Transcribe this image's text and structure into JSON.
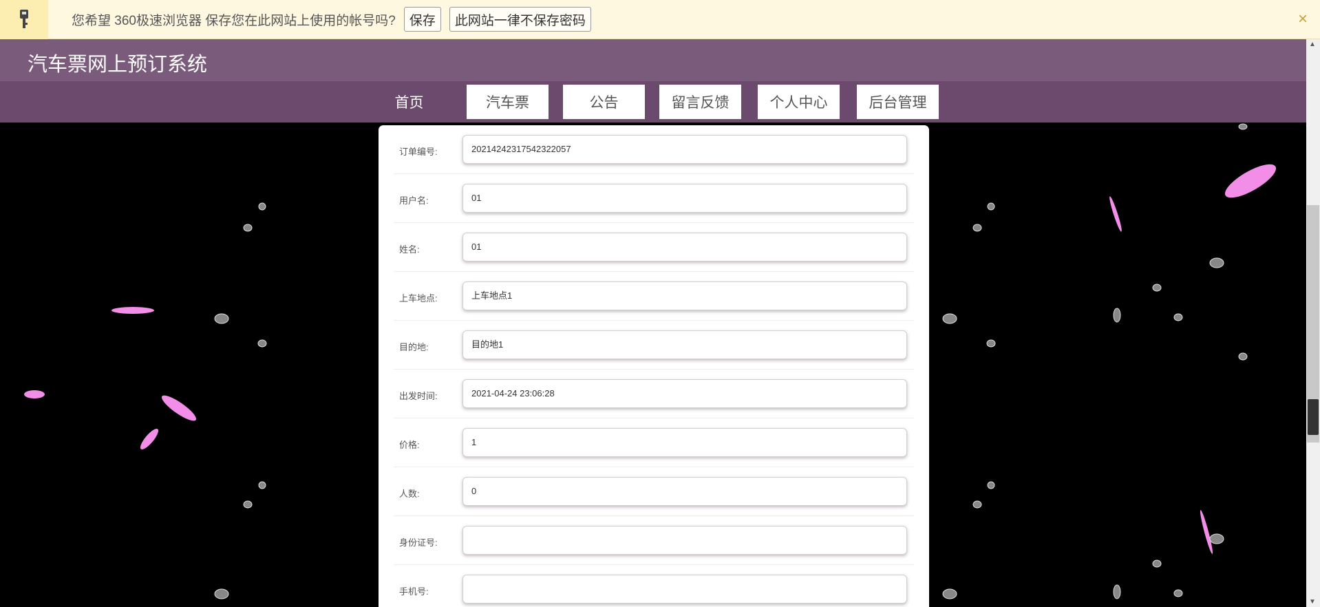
{
  "infobar": {
    "message": "您希望 360极速浏览器 保存您在此网站上使用的帐号吗?",
    "save_label": "保存",
    "never_label": "此网站一律不保存密码",
    "close_icon": "×",
    "colors": {
      "bg": "#fff8e1"
    }
  },
  "header": {
    "title": "汽车票网上预订系统"
  },
  "nav": {
    "items": [
      {
        "label": "首页"
      },
      {
        "label": "汽车票"
      },
      {
        "label": "公告"
      },
      {
        "label": "留言反馈"
      },
      {
        "label": "个人中心"
      },
      {
        "label": "后台管理"
      }
    ]
  },
  "form": {
    "fields": [
      {
        "label": "订单编号:",
        "value": "20214242317542322057"
      },
      {
        "label": "用户名:",
        "value": "01"
      },
      {
        "label": "姓名:",
        "value": "01"
      },
      {
        "label": "上车地点:",
        "value": "上车地点1"
      },
      {
        "label": "目的地:",
        "value": "目的地1"
      },
      {
        "label": "出发时间:",
        "value": "2021-04-24 23:06:28"
      },
      {
        "label": "价格:",
        "value": "1"
      },
      {
        "label": "人数:",
        "value": "0"
      },
      {
        "label": "身份证号:",
        "value": ""
      },
      {
        "label": "手机号:",
        "value": ""
      }
    ]
  }
}
